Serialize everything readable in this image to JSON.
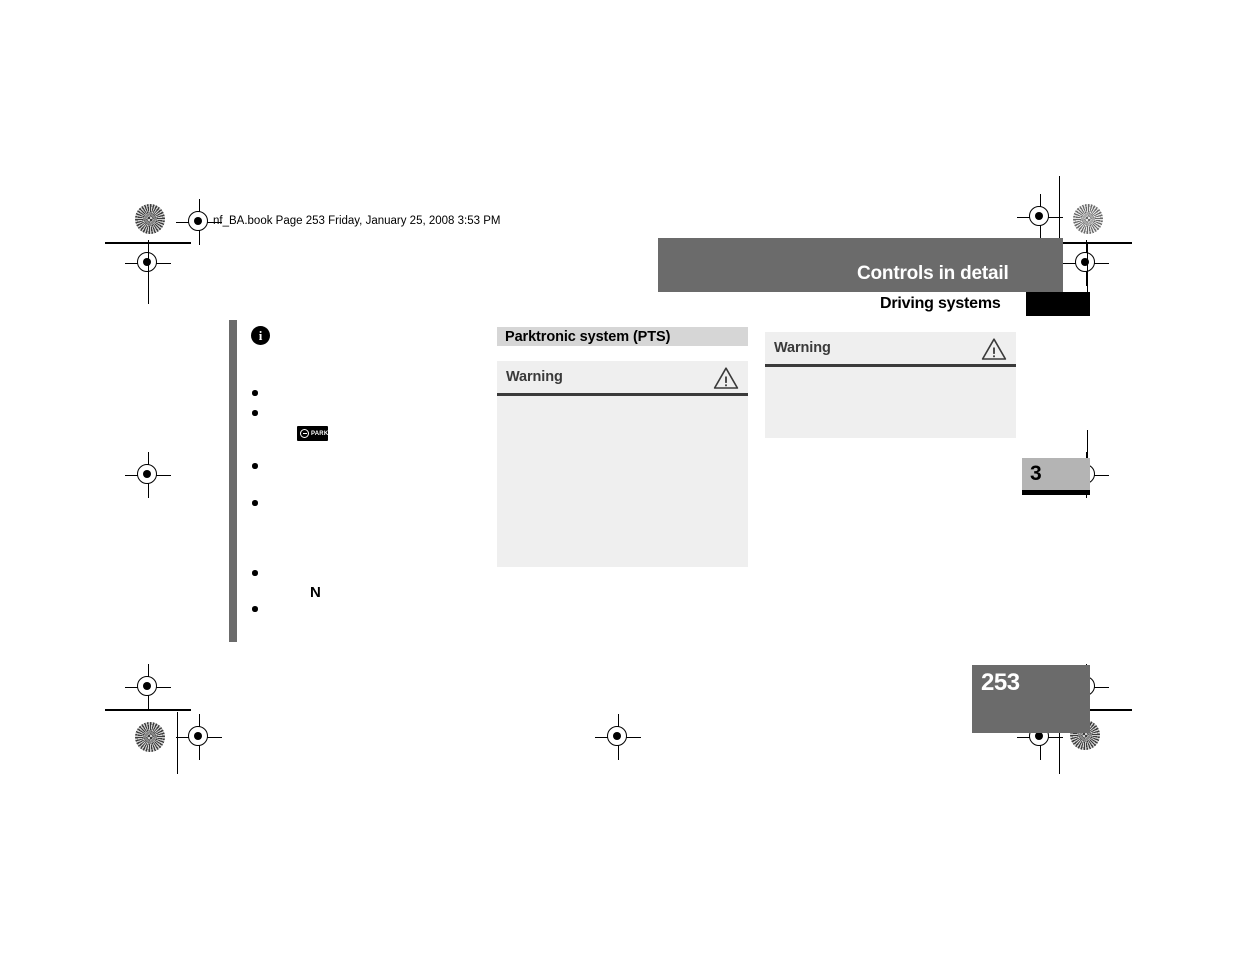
{
  "document": {
    "filestamp": "nf_BA.book  Page 253  Friday, January 25, 2008  3:53 PM",
    "page_number": "253",
    "chapter_number": "3"
  },
  "header": {
    "title": "Controls in detail",
    "subtitle": "Driving systems"
  },
  "left_column": {
    "info_icon_glyph": "i",
    "park_badge": {
      "label": "PARK",
      "icon": "park-ring-icon"
    },
    "inline_glyph": "N",
    "bullets": [
      "",
      "",
      "",
      "",
      "",
      ""
    ]
  },
  "middle_column": {
    "section_heading": "Parktronic system (PTS)",
    "warning_box": {
      "title": "Warning",
      "icon": "warning-triangle-icon",
      "body": ""
    }
  },
  "right_column": {
    "warning_box": {
      "title": "Warning",
      "icon": "warning-triangle-icon",
      "body": ""
    }
  },
  "colors": {
    "header_bar": "#6b6b6b",
    "section_heading_bg": "#d6d6d6",
    "warning_bg": "#efefef",
    "warning_rule": "#3a3a3a",
    "chapter_tab": "#b4b4b4",
    "folio_bg": "#6b6b6b",
    "accent_black": "#000000"
  }
}
